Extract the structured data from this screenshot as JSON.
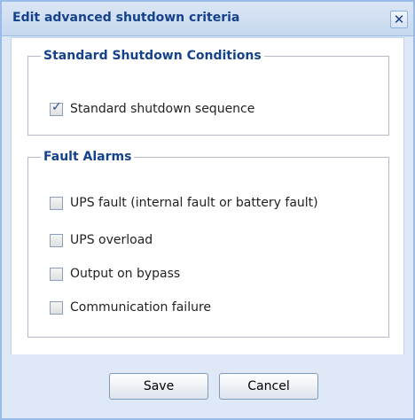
{
  "dialog": {
    "title": "Edit advanced shutdown criteria",
    "close_icon": "close-icon"
  },
  "standard": {
    "legend": "Standard Shutdown Conditions",
    "items": [
      {
        "label": "Standard shutdown sequence",
        "checked": true
      }
    ]
  },
  "faults": {
    "legend": "Fault Alarms",
    "items": [
      {
        "label": "UPS fault (internal fault or battery fault)",
        "checked": false
      },
      {
        "label": "UPS overload",
        "checked": false
      },
      {
        "label": "Output on bypass",
        "checked": false
      },
      {
        "label": "Communication failure",
        "checked": false
      }
    ]
  },
  "buttons": {
    "save": "Save",
    "cancel": "Cancel"
  },
  "colors": {
    "title_text": "#15428b",
    "window_frame": "#99bbe8",
    "footer_bg": "#dfe8f6"
  }
}
